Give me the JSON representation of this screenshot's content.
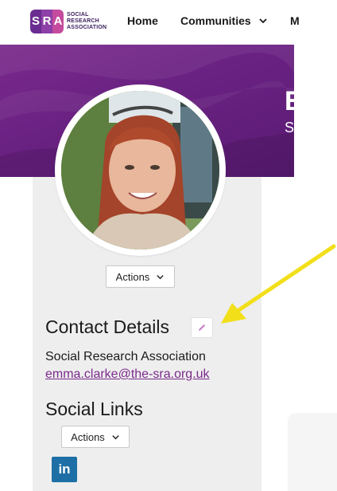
{
  "nav": {
    "logo": {
      "letters": [
        "S",
        "R",
        "A"
      ],
      "lines": [
        "SOCIAL",
        "RESEARCH",
        "ASSOCIATION"
      ]
    },
    "home": "Home",
    "communities": "Communities",
    "more": "M"
  },
  "banner": {
    "name_partial": "E",
    "sub_partial": "S"
  },
  "profile": {
    "actions_label": "Actions"
  },
  "contact": {
    "title": "Contact Details",
    "organization": "Social Research Association",
    "email": "emma.clarke@the-sra.org.uk"
  },
  "social": {
    "title": "Social Links",
    "actions_label": "Actions",
    "linkedin_label": "in"
  },
  "colors": {
    "brand_purple": "#6b2283",
    "link_purple": "#7a2a8c",
    "linkedin_blue": "#1d6fa5",
    "arrow_yellow": "#f2df1a",
    "edit_pencil": "#c77dc2"
  },
  "icons": {
    "edit": "pencil-icon",
    "dropdown": "chevron-down-icon",
    "annotation": "arrow-annotation-icon"
  }
}
